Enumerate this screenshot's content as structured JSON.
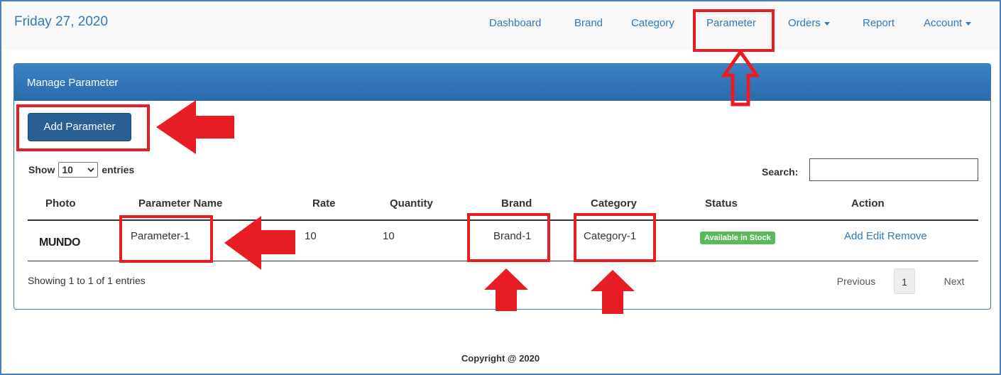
{
  "nav": {
    "date": "Friday 27, 2020",
    "items": [
      {
        "label": "Dashboard"
      },
      {
        "label": "Brand"
      },
      {
        "label": "Category"
      },
      {
        "label": "Parameter"
      },
      {
        "label": "Orders"
      },
      {
        "label": "Report"
      },
      {
        "label": "Account"
      }
    ]
  },
  "panel": {
    "title": "Manage Parameter",
    "add_button": "Add Parameter"
  },
  "table_controls": {
    "show_label": "Show",
    "entries_value": "10",
    "entries_label": "entries",
    "search_label": "Search:",
    "search_value": ""
  },
  "table": {
    "columns": [
      "Photo",
      "Parameter Name",
      "Rate",
      "Quantity",
      "Brand",
      "Category",
      "Status",
      "Action"
    ],
    "rows": [
      {
        "photo_text": "MUNDO",
        "parameter_name": "Parameter-1",
        "rate": "10",
        "quantity": "10",
        "brand": "Brand-1",
        "category": "Category-1",
        "status": "Available in Stock",
        "actions": [
          "Add",
          "Edit",
          "Remove"
        ]
      }
    ]
  },
  "pagination": {
    "info": "Showing 1 to 1 of 1 entries",
    "previous": "Previous",
    "current_page": "1",
    "next": "Next"
  },
  "footer": {
    "copyright": "Copyright @ 2020"
  },
  "colors": {
    "link": "#337ab7",
    "panel_header": "#337ab7",
    "annotation_red": "#e81c24",
    "status_green": "#5cb85c"
  }
}
